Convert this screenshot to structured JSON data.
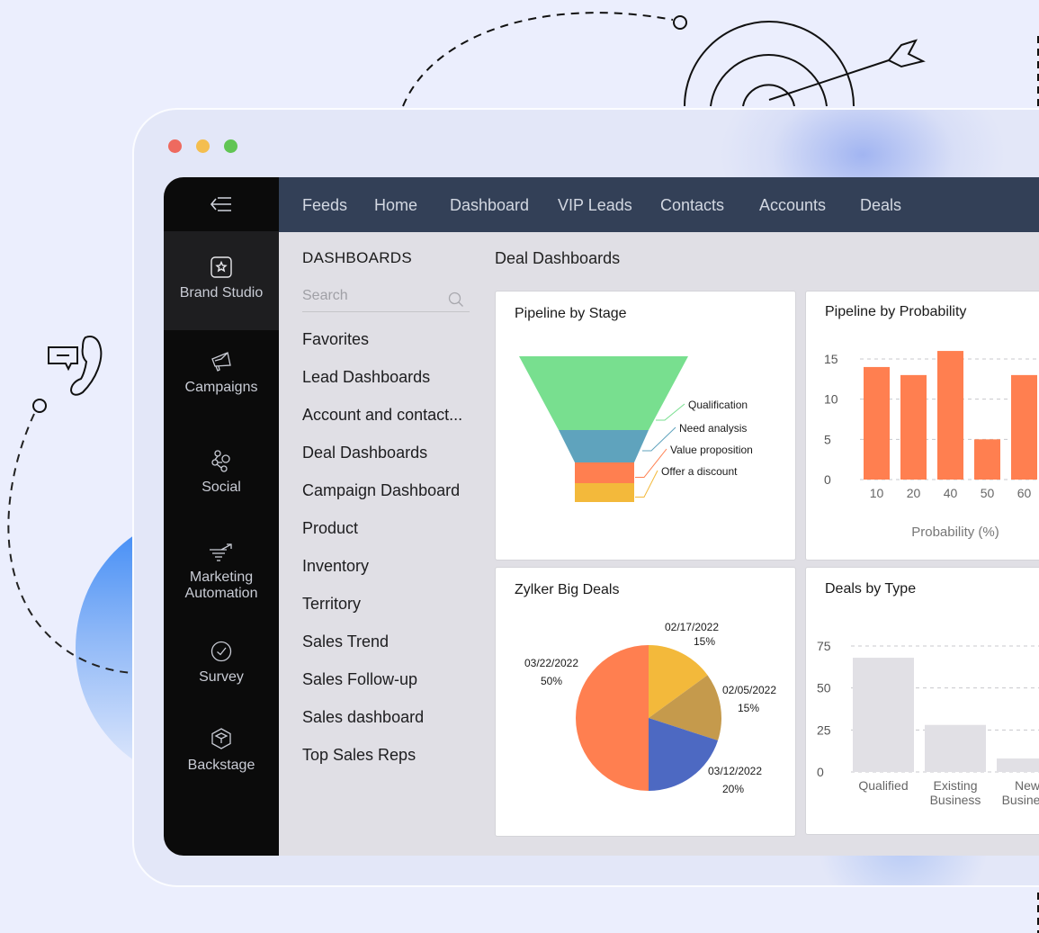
{
  "window": {
    "traffic_lights": [
      {
        "name": "close",
        "color": "#ee6a5f"
      },
      {
        "name": "minimize",
        "color": "#f4be4f"
      },
      {
        "name": "maximize",
        "color": "#61c554"
      }
    ]
  },
  "sidebar": {
    "collapse_icon": "collapse-menu-icon",
    "items": [
      {
        "label": "Brand Studio",
        "icon": "star-badge-icon",
        "active": true
      },
      {
        "label": "Campaigns",
        "icon": "megaphone-icon",
        "active": false
      },
      {
        "label": "Social",
        "icon": "social-share-icon",
        "active": false
      },
      {
        "label": "Marketing Automation",
        "icon": "funnel-arrow-icon",
        "active": false
      },
      {
        "label": "Survey",
        "icon": "check-circle-icon",
        "active": false
      },
      {
        "label": "Backstage",
        "icon": "cube-icon",
        "active": false
      }
    ]
  },
  "topnav": {
    "tabs": [
      "Feeds",
      "Home",
      "Dashboard",
      "VIP Leads",
      "Contacts",
      "Accounts",
      "Deals"
    ]
  },
  "dashboards_panel": {
    "title": "DASHBOARDS",
    "search_placeholder": "Search",
    "items": [
      "Favorites",
      "Lead Dashboards",
      "Account and contact...",
      "Deal Dashboards",
      "Campaign Dashboard",
      "Product",
      "Inventory",
      "Territory",
      "Sales Trend",
      "Sales Follow-up",
      "Sales dashboard",
      "Top Sales Reps"
    ]
  },
  "main": {
    "title": "Deal Dashboards"
  },
  "chart_data": [
    {
      "type": "funnel",
      "title": "Pipeline by Stage",
      "categories": [
        "Qualification",
        "Need analysis",
        "Value proposition",
        "Offer a discount"
      ],
      "colors": [
        "#78df8f",
        "#5fa3bd",
        "#ff7f50",
        "#f3b93b"
      ]
    },
    {
      "type": "bar",
      "title": "Pipeline by Probability",
      "categories": [
        "10",
        "20",
        "40",
        "50",
        "60"
      ],
      "values": [
        14,
        13,
        16,
        5,
        13
      ],
      "xlabel": "Probability (%)",
      "ylabel": "",
      "yticks": [
        0,
        5,
        10,
        15
      ],
      "ylim": [
        0,
        15
      ],
      "grid": true,
      "color": "#ff7f50"
    },
    {
      "type": "pie",
      "title": "Zylker Big Deals",
      "slices": [
        {
          "label": "02/17/2022",
          "value": 15,
          "display": "15%",
          "color": "#f3b93b"
        },
        {
          "label": "02/05/2022",
          "value": 15,
          "display": "15%",
          "color": "#c59a4c"
        },
        {
          "label": "03/12/2022",
          "value": 20,
          "display": "20%",
          "color": "#4d69c2"
        },
        {
          "label": "03/22/2022",
          "value": 50,
          "display": "50%",
          "color": "#ff7f50"
        }
      ]
    },
    {
      "type": "bar",
      "title": "Deals by Type",
      "categories": [
        "Qualified",
        "Existing Business",
        "New Business"
      ],
      "category_lines": [
        [
          "Qualified"
        ],
        [
          "Existing",
          "Business"
        ],
        [
          "New",
          "Business"
        ]
      ],
      "values": [
        68,
        28,
        8
      ],
      "yticks": [
        0,
        25,
        50,
        75
      ],
      "ylim": [
        0,
        75
      ],
      "grid": true,
      "color": "#e1e0e5"
    }
  ]
}
